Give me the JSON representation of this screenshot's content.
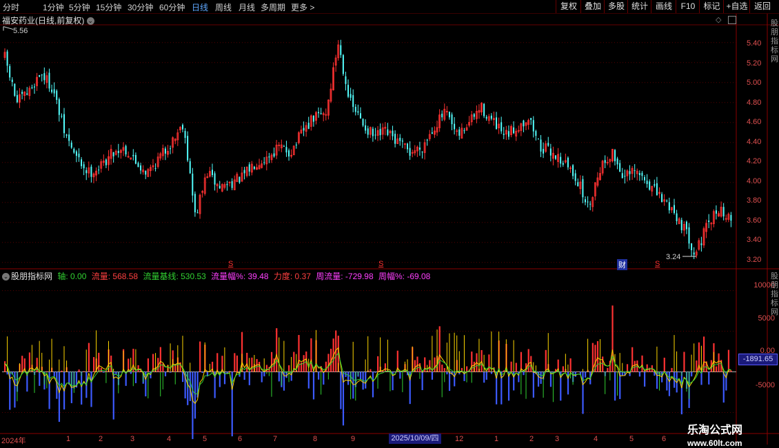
{
  "toolbar": {
    "periods": [
      "分时",
      "1分钟",
      "5分钟",
      "15分钟",
      "30分钟",
      "60分钟",
      "日线",
      "周线",
      "月线",
      "多周期",
      "更多"
    ],
    "active_period": "日线",
    "actions": [
      "复权",
      "叠加",
      "多股",
      "统计",
      "画线",
      "F10",
      "标记",
      "+自选",
      "返回"
    ]
  },
  "stock_title": "福安药业(日线,前复权)",
  "price_axis": [
    "5.40",
    "5.20",
    "5.00",
    "4.80",
    "4.60",
    "4.40",
    "4.20",
    "4.00",
    "3.80",
    "3.60",
    "3.40",
    "3.20"
  ],
  "high_label": "5.56",
  "low_label": "3.24",
  "marks": {
    "s1": "S",
    "s2": "S",
    "s3": "S",
    "cai": "财"
  },
  "indicator": {
    "name": "股朋指标网",
    "axis_label": "轴: 0.00",
    "flow_label": "流量: 568.58",
    "flow_base_label": "流量基线: 530.53",
    "flow_pct_label": "流量幅%: 39.48",
    "force_label": "力度: 0.37",
    "week_flow_label": "周流量: -729.98",
    "week_pct_label": "周幅%: -69.08"
  },
  "indicator_axis": [
    "10000",
    "5000",
    "0.00",
    "-5000"
  ],
  "current_value": "-1891.65",
  "date_axis": [
    "2024年",
    "1",
    "2",
    "3",
    "4",
    "5",
    "6",
    "7",
    "8",
    "9",
    "12",
    "1",
    "2",
    "3",
    "4",
    "5",
    "6"
  ],
  "current_date": "2025/10/09/四",
  "watermark": {
    "line1": "乐淘公式网",
    "line2": "www.60lt.com"
  },
  "side_text": "股朋指标网",
  "colors": {
    "up": "#ff3232",
    "down": "#54ffff",
    "bg": "#000000",
    "grid": "#5a0000",
    "blue": "#3c5aff",
    "yellow": "#ffd700",
    "green": "#32d232"
  },
  "chart_data": {
    "type": "candlestick",
    "title": "福安药业(日线,前复权)",
    "ylim": [
      3.15,
      5.55
    ],
    "y_ticks": [
      3.2,
      3.4,
      3.6,
      3.8,
      4.0,
      4.2,
      4.4,
      4.6,
      4.8,
      5.0,
      5.2,
      5.4
    ],
    "marked_high": 5.56,
    "marked_low": 3.24,
    "close_path": [
      5.25,
      4.8,
      4.9,
      5.1,
      4.95,
      4.5,
      4.25,
      4.1,
      4.15,
      4.3,
      4.35,
      4.2,
      4.1,
      4.25,
      4.4,
      4.6,
      3.65,
      4.1,
      3.95,
      4.0,
      4.05,
      4.2,
      4.25,
      4.35,
      4.3,
      4.5,
      4.65,
      4.7,
      5.4,
      4.8,
      4.6,
      4.45,
      4.5,
      4.4,
      4.3,
      4.35,
      4.55,
      4.7,
      4.45,
      4.6,
      4.75,
      4.6,
      4.45,
      4.55,
      4.65,
      4.35,
      4.3,
      4.2,
      4.05,
      3.75,
      4.15,
      4.3,
      4.05,
      4.1,
      4.0,
      3.85,
      3.75,
      3.55,
      3.3,
      3.55,
      3.75,
      3.6
    ],
    "indicator_ylim": [
      -7500,
      12000
    ],
    "indicator_ticks": [
      10000,
      5000,
      0,
      -5000
    ],
    "indicator_last": -1891.65
  }
}
